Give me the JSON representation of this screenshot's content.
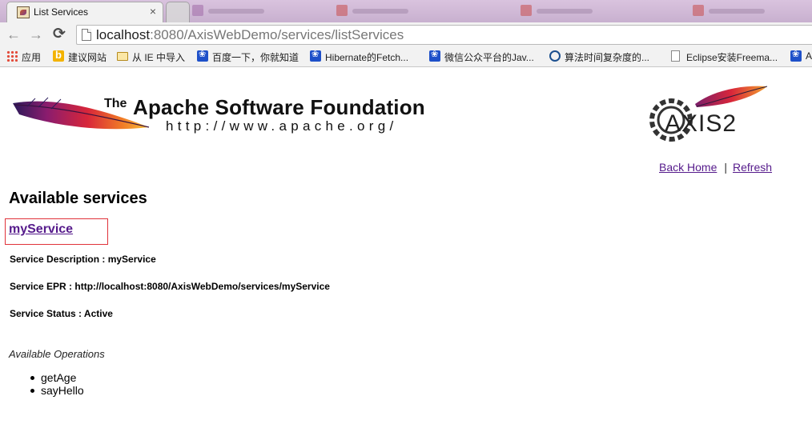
{
  "browser": {
    "tab": {
      "title": "List Services",
      "close": "×"
    },
    "toolbar": {
      "back": "←",
      "forward": "→",
      "reload": "⟳"
    },
    "address": {
      "host": "localhost",
      "path": ":8080/AxisWebDemo/services/listServices"
    },
    "bookmarks": [
      {
        "label": "应用",
        "icon": "apps-grid-icon"
      },
      {
        "label": "建议网站",
        "icon": "bing-icon"
      },
      {
        "label": "从 IE 中导入",
        "icon": "folder-icon"
      },
      {
        "label": "百度一下，你就知道",
        "icon": "baidu-paw-icon"
      },
      {
        "label": "Hibernate的Fetch...",
        "icon": "baidu-paw-icon"
      },
      {
        "label": "微信公众平台的Jav...",
        "icon": "baidu-paw-icon"
      },
      {
        "label": "算法时间复杂度的...",
        "icon": "circle-c-icon"
      },
      {
        "label": "Eclipse安装Freema...",
        "icon": "page-icon"
      },
      {
        "label": "A",
        "icon": "baidu-paw-icon"
      }
    ]
  },
  "header": {
    "asf_the": "The",
    "asf_name": "Apache Software Foundation",
    "asf_url": "http://www.apache.org/"
  },
  "nav": {
    "back_home": "Back Home",
    "separator": "|",
    "refresh": "Refresh"
  },
  "main": {
    "title": "Available services",
    "service": {
      "name": "myService",
      "description": "Service Description : myService",
      "epr": "Service EPR : http://localhost:8080/AxisWebDemo/services/myService",
      "status": "Service Status : Active"
    },
    "operations_title": "Available Operations",
    "operations": [
      "getAge",
      "sayHello"
    ]
  },
  "colors": {
    "link": "#551a8b",
    "highlight_box": "#e0323a",
    "tabstrip": "#d9c3de"
  }
}
